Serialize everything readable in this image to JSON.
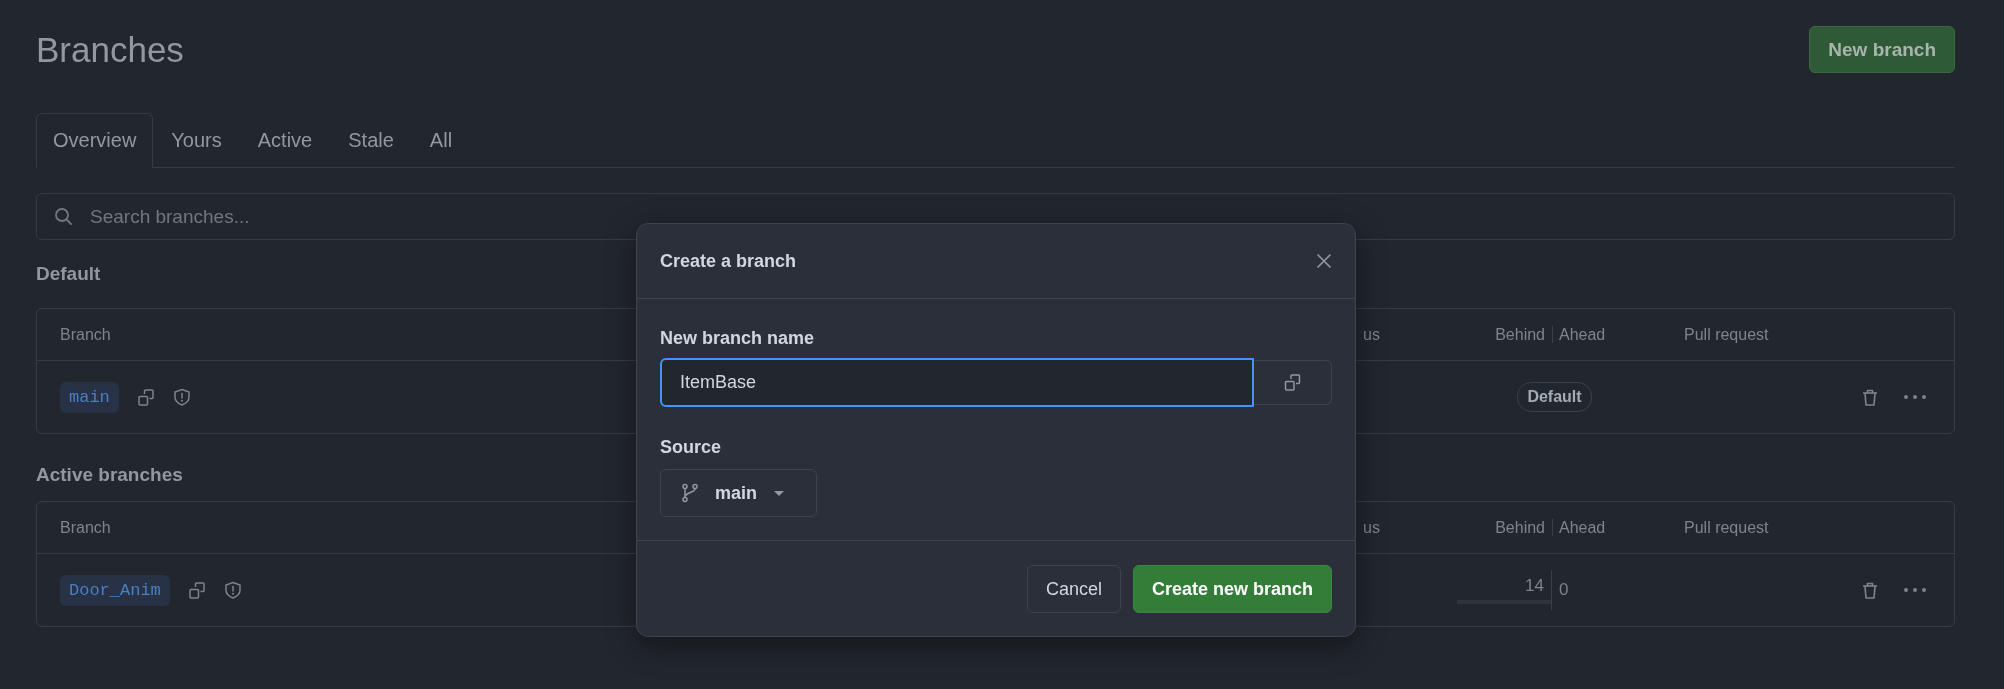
{
  "page": {
    "title": "Branches",
    "new_branch_button": "New branch"
  },
  "tabs": [
    {
      "label": "Overview",
      "selected": true
    },
    {
      "label": "Yours",
      "selected": false
    },
    {
      "label": "Active",
      "selected": false
    },
    {
      "label": "Stale",
      "selected": false
    },
    {
      "label": "All",
      "selected": false
    }
  ],
  "search": {
    "placeholder": "Search branches..."
  },
  "sections": [
    {
      "heading": "Default",
      "columns": {
        "branch": "Branch",
        "column_2": "us",
        "behind": "Behind",
        "ahead": "Ahead",
        "pull_request": "Pull request"
      },
      "rows": [
        {
          "kind": "default",
          "name": "main",
          "badge": "Default"
        }
      ]
    },
    {
      "heading": "Active branches",
      "columns": {
        "branch": "Branch",
        "column_2": "us",
        "behind": "Behind",
        "ahead": "Ahead",
        "pull_request": "Pull request"
      },
      "rows": [
        {
          "kind": "compare",
          "name": "Door_Anim",
          "behind": "14",
          "ahead": "0",
          "behind_bar": {
            "level": 0.75
          }
        }
      ]
    }
  ],
  "dialog": {
    "title": "Create a branch",
    "name_label": "New branch name",
    "name_value": "ItemBase",
    "source_label": "Source",
    "source_value": "main",
    "buttons": [
      {
        "label": "Cancel",
        "kind": "secondary"
      },
      {
        "label": "Create new branch",
        "kind": "primary"
      }
    ]
  }
}
